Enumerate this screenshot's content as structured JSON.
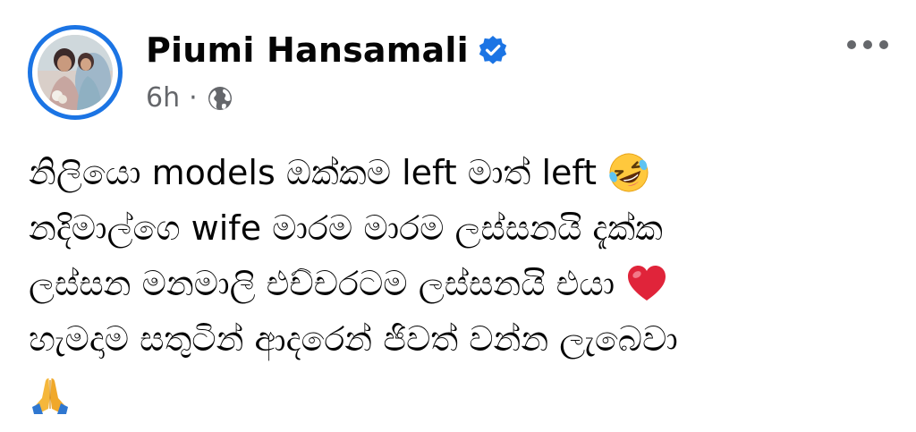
{
  "post": {
    "author": "Piumi Hansamali",
    "verified": true,
    "timestamp": "6h",
    "separator": "·",
    "audience_icon": "globe-icon",
    "more_icon": "more-options-icon",
    "lines": [
      "නිලියො models ඔක්කම left මාත් left",
      "නදිමාල්ගෙ wife මාරම මාරම ලස්සනයි දැක්ක",
      "ලස්සන මනමාලි එච්චරටම ලස්සනයි එයා",
      "හැමදාම සතුටින් ආදරෙන් ජිවත් වන්න ලැබෙවා"
    ],
    "emojis": {
      "line1": "rolling-on-floor-laughing-emoji",
      "line3": "red-heart-emoji",
      "line5": "folded-hands-emoji"
    },
    "colors": {
      "verified_badge": "#1b74e4",
      "secondary_text": "#65676b",
      "primary_text": "#050505",
      "avatar_ring": "#1b74e4"
    }
  }
}
